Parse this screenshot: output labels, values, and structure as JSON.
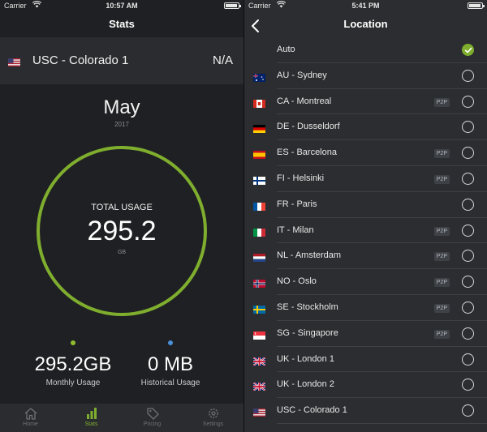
{
  "left": {
    "status": {
      "carrier": "Carrier",
      "time": "10:57 AM",
      "battery_level": 0.9
    },
    "title": "Stats",
    "location": {
      "name": "USC - Colorado 1",
      "value": "N/A",
      "flag": "us"
    },
    "month": "May",
    "year": "2017",
    "total": {
      "label": "TOTAL USAGE",
      "value": "295.2",
      "unit": "GB"
    },
    "monthly": {
      "value": "295.2GB",
      "label": "Monthly Usage",
      "dot_color": "#8fbd2f"
    },
    "historical": {
      "value": "0 MB",
      "label": "Historical Usage",
      "dot_color": "#4a90d9"
    },
    "tabs": [
      {
        "label": "Home",
        "icon": "home-icon",
        "active": false
      },
      {
        "label": "Stats",
        "icon": "bar-chart-icon",
        "active": true
      },
      {
        "label": "Pricing",
        "icon": "price-tag-icon",
        "active": false
      },
      {
        "label": "Settings",
        "icon": "gear-icon",
        "active": false
      }
    ]
  },
  "right": {
    "status": {
      "carrier": "Carrier",
      "time": "5:41 PM",
      "battery_level": 0.9
    },
    "title": "Location",
    "back_icon": "chevron-left-icon",
    "locations": [
      {
        "name": "Auto",
        "flag": "",
        "p2p": "",
        "selected": true
      },
      {
        "name": "AU - Sydney",
        "flag": "au",
        "p2p": "",
        "selected": false
      },
      {
        "name": "CA - Montreal",
        "flag": "ca",
        "p2p": "P2P",
        "selected": false
      },
      {
        "name": "DE - Dusseldorf",
        "flag": "de",
        "p2p": "",
        "selected": false
      },
      {
        "name": "ES - Barcelona",
        "flag": "es",
        "p2p": "P2P",
        "selected": false
      },
      {
        "name": "FI - Helsinki",
        "flag": "fi",
        "p2p": "P2P",
        "selected": false
      },
      {
        "name": "FR - Paris",
        "flag": "fr",
        "p2p": "",
        "selected": false
      },
      {
        "name": "IT - Milan",
        "flag": "it",
        "p2p": "P2P",
        "selected": false
      },
      {
        "name": "NL - Amsterdam",
        "flag": "nl",
        "p2p": "P2P",
        "selected": false
      },
      {
        "name": "NO - Oslo",
        "flag": "no",
        "p2p": "P2P",
        "selected": false
      },
      {
        "name": "SE - Stockholm",
        "flag": "se",
        "p2p": "P2P",
        "selected": false
      },
      {
        "name": "SG - Singapore",
        "flag": "sg",
        "p2p": "P2P",
        "selected": false
      },
      {
        "name": "UK - London 1",
        "flag": "uk",
        "p2p": "",
        "selected": false
      },
      {
        "name": "UK - London 2",
        "flag": "uk",
        "p2p": "",
        "selected": false
      },
      {
        "name": "USC - Colorado 1",
        "flag": "us",
        "p2p": "",
        "selected": false
      }
    ]
  },
  "colors": {
    "accent": "#7fae2e",
    "background": "#1f2023",
    "panel": "#2a2c2f"
  }
}
